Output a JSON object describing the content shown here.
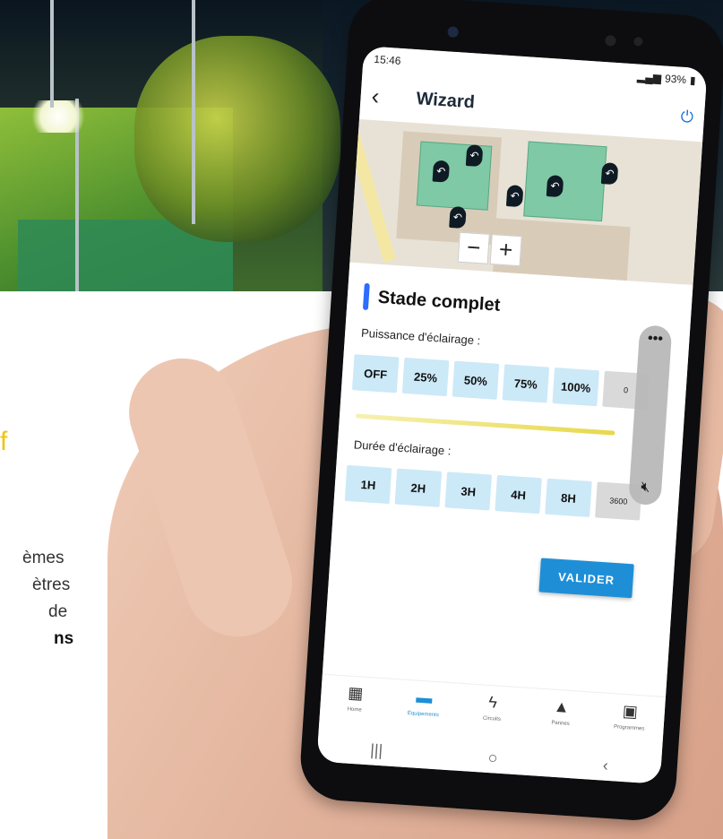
{
  "background": {
    "text_fragments": [
      {
        "text": "f",
        "style": "yellow"
      },
      {
        "text": "èmes"
      },
      {
        "text": "ètres"
      },
      {
        "text": "de"
      },
      {
        "text": "ns",
        "bold": true
      }
    ]
  },
  "status_bar": {
    "time": "15:46",
    "battery": "93%"
  },
  "app_bar": {
    "title": "Wizard"
  },
  "map": {
    "zoom_out": "−",
    "zoom_in": "+"
  },
  "zone": {
    "name": "Stade complet",
    "power_label": "Puissance d'éclairage :",
    "power_options": [
      "OFF",
      "25%",
      "50%",
      "75%",
      "100%"
    ],
    "power_extra_partial": "0",
    "duration_label": "Durée d'éclairage :",
    "duration_options": [
      "1H",
      "2H",
      "3H",
      "4H",
      "8H"
    ],
    "duration_extra": "3600",
    "submit": "VALIDER"
  },
  "volume_panel": {
    "more": "•••",
    "mute_icon": "volume-mute-icon"
  },
  "bottom_nav": {
    "items": [
      {
        "label": "Home",
        "icon": "dashboard-icon"
      },
      {
        "label": "Équipements",
        "icon": "floodlight-icon",
        "active": true
      },
      {
        "label": "Circuits",
        "icon": "lightning-icon"
      },
      {
        "label": "Pannes",
        "icon": "warning-icon"
      },
      {
        "label": "Programmes",
        "icon": "calendar-icon"
      }
    ]
  },
  "system_nav": {
    "recent": "|||",
    "home": "○",
    "back": "‹"
  },
  "colors": {
    "accent": "#1e8fd6",
    "option_bg": "#cce9f8",
    "title_bar": "#2f6bff",
    "slider": "#e7d84a",
    "brand_yellow": "#f1c40f"
  }
}
